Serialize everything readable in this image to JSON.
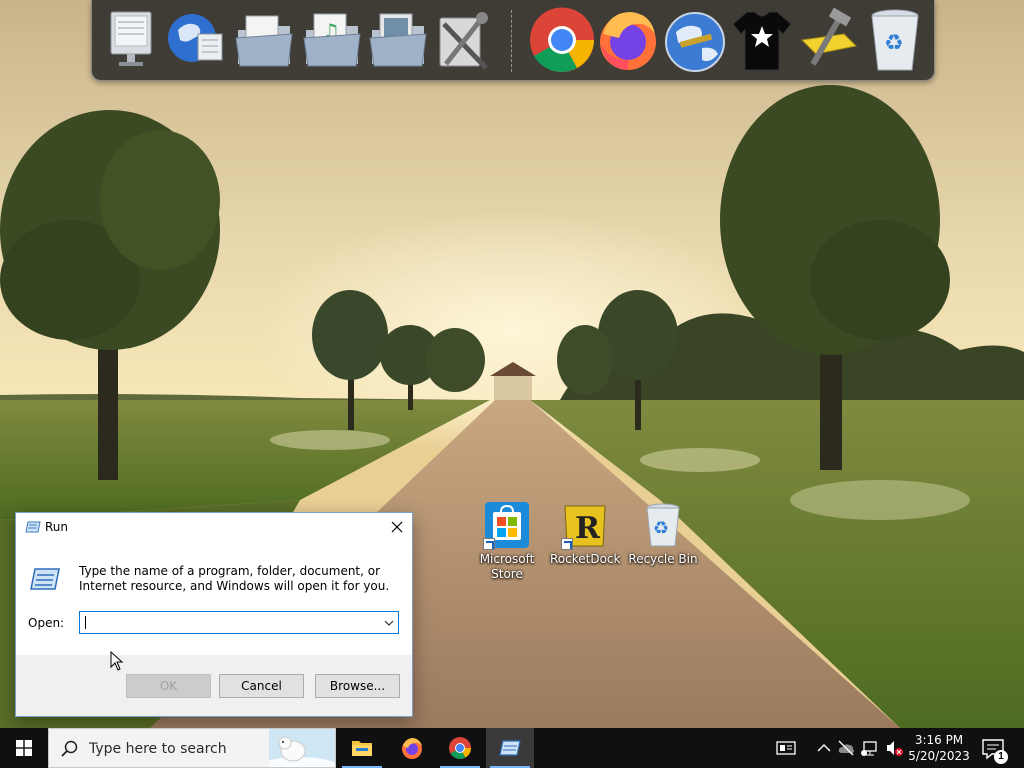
{
  "dock": {
    "items": [
      {
        "name": "my-computer",
        "icon": "computer-icon"
      },
      {
        "name": "network",
        "icon": "globe-network-icon"
      },
      {
        "name": "documents",
        "icon": "documents-folder-icon"
      },
      {
        "name": "music",
        "icon": "music-folder-icon"
      },
      {
        "name": "pictures",
        "icon": "pictures-folder-icon"
      },
      {
        "name": "control-panel",
        "icon": "tools-icon"
      },
      {
        "name": "chrome",
        "icon": "chrome-icon"
      },
      {
        "name": "firefox",
        "icon": "firefox-icon"
      },
      {
        "name": "browser",
        "icon": "globe-icon"
      },
      {
        "name": "shirt",
        "icon": "tshirt-icon"
      },
      {
        "name": "settings",
        "icon": "hammer-icon"
      },
      {
        "name": "recycle-bin",
        "icon": "recycle-bin-icon"
      }
    ]
  },
  "desktop": {
    "icons": [
      {
        "label": "Microsoft Store",
        "icon": "store-icon"
      },
      {
        "label": "RocketDock",
        "icon": "rocketdock-icon"
      },
      {
        "label": "Recycle Bin",
        "icon": "recycle-bin-icon"
      }
    ]
  },
  "run_dialog": {
    "title": "Run",
    "description": "Type the name of a program, folder, document, or Internet resource, and Windows will open it for you.",
    "open_label": "Open:",
    "open_value": "",
    "ok_label": "OK",
    "cancel_label": "Cancel",
    "browse_label": "Browse..."
  },
  "taskbar": {
    "search_placeholder": "Type here to search",
    "apps": [
      "file-explorer",
      "firefox",
      "chrome",
      "run"
    ],
    "clock_time": "3:16 PM",
    "clock_date": "5/20/2023",
    "notification_count": "1"
  },
  "colors": {
    "taskbar": "#101010",
    "accent": "#0078d7",
    "dock_bg": "#282828"
  }
}
